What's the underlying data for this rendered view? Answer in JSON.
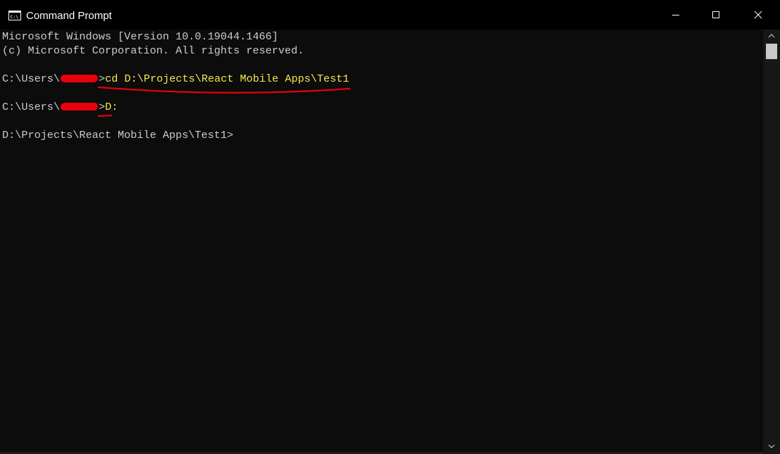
{
  "window": {
    "title": "Command Prompt",
    "icon": "cmd-app-icon",
    "controls": {
      "minimize": "minimize-icon",
      "maximize": "maximize-icon",
      "close": "close-icon"
    }
  },
  "console": {
    "lines": [
      {
        "text": "Microsoft Windows [Version 10.0.19044.1466]"
      },
      {
        "text": "(c) Microsoft Corporation. All rights reserved."
      },
      {
        "prompt_prefix": "C:\\Users\\",
        "prompt_suffix": ">",
        "command": "cd D:\\Projects\\React Mobile Apps\\Test1"
      },
      {
        "prompt_prefix": "C:\\Users\\",
        "prompt_suffix": ">",
        "command": "D:"
      },
      {
        "text": "D:\\Projects\\React Mobile Apps\\Test1>"
      }
    ]
  },
  "colors": {
    "background": "#0c0c0c",
    "text": "#cccccc",
    "highlighted_command": "#f5e94a",
    "annotation_red": "#e8000b"
  }
}
